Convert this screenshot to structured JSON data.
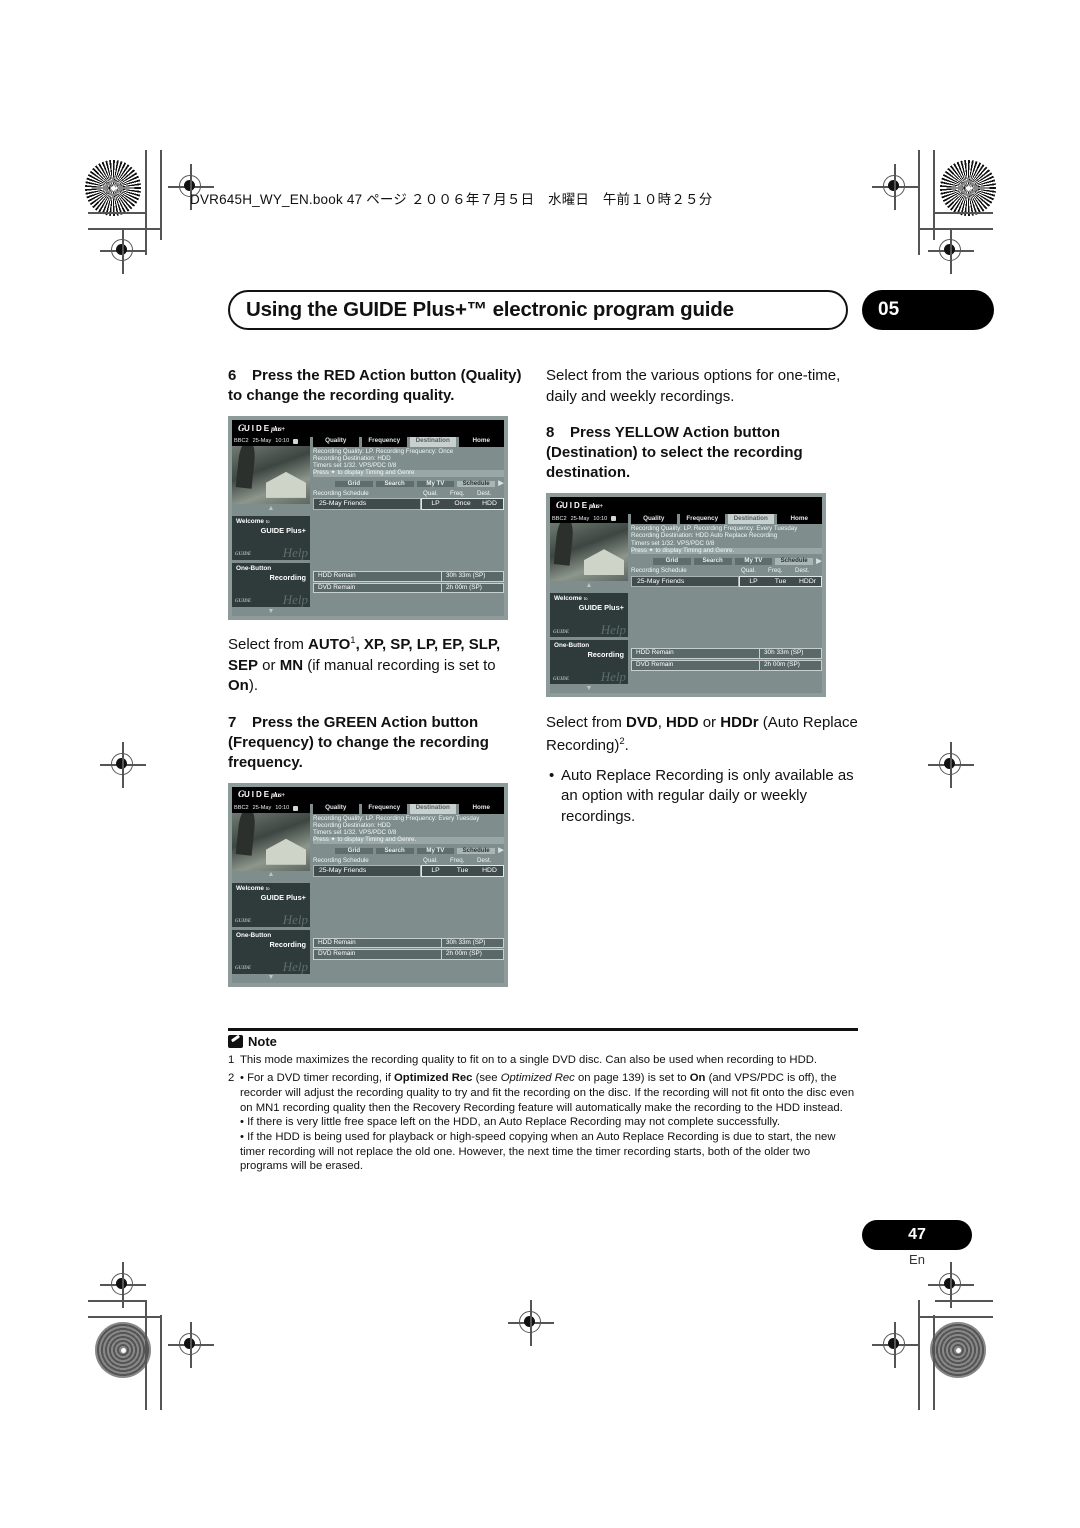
{
  "book_header": "DVR645H_WY_EN.book 47 ページ ２００６年７月５日　水曜日　午前１０時２５分",
  "title": "Using the GUIDE Plus+™ electronic program guide",
  "chapter": "05",
  "page_number": "47",
  "page_lang": "En",
  "left_column": {
    "step6": {
      "num": "6",
      "text": "Press the RED Action button (Quality) to change the recording quality."
    },
    "select_quality": {
      "lead": "Select from ",
      "auto": "AUTO",
      "sup": "1",
      "list": ", XP, SP, LP, EP, SLP, SEP",
      "or": " or ",
      "mn": "MN",
      "tail_pre": " (if manual recording is set to ",
      "on": "On",
      "tail_post": ")."
    },
    "step7": {
      "num": "7",
      "text": "Press the GREEN Action button (Frequency) to change the recording frequency."
    }
  },
  "right_column": {
    "intro": "Select from the various options for one-time, daily and weekly recordings.",
    "step8": {
      "num": "8",
      "text": "Press YELLOW Action button (Destination) to select the recording destination."
    },
    "select_dest": {
      "lead": "Select from ",
      "dvd": "DVD",
      "sep1": ", ",
      "hdd": "HDD",
      "sep2": " or ",
      "hddr": "HDDr",
      "tail": " (Auto Replace Recording)",
      "sup": "2",
      "period": "."
    },
    "bullets": [
      "Auto Replace Recording is only available as an option with regular daily or weekly recordings."
    ]
  },
  "figures": [
    {
      "logo": "GUIDE Plus+",
      "channel": "BBC2",
      "date": "25-May",
      "time": "10:10",
      "tabs": [
        {
          "label": "Quality",
          "selected": false
        },
        {
          "label": "Frequency",
          "selected": false
        },
        {
          "label": "Destination",
          "selected": true
        },
        {
          "label": "Home",
          "selected": false
        }
      ],
      "info": [
        "Recording Quality: LP. Recording Frequency: Once",
        "Recording Destination: HDD",
        "Timers set 1/32. VPS/PDC 0/8",
        "Press ✦ to display Timing and Genre"
      ],
      "nav": [
        {
          "label": "Grid",
          "selected": false
        },
        {
          "label": "Search",
          "selected": false
        },
        {
          "label": "My TV",
          "selected": false
        },
        {
          "label": "Schedule",
          "selected": true
        }
      ],
      "schedule_header": {
        "name": "Recording Schedule",
        "qual": "Qual.",
        "freq": "Freq.",
        "dest": "Dest."
      },
      "schedule_row": {
        "name": "25-May  Friends",
        "qual": "LP",
        "freq": "Once",
        "dest": "HDD"
      },
      "tiles": [
        {
          "line1": "Welcome",
          "small": "to",
          "line2": "GUIDE Plus+",
          "help": "Help"
        },
        {
          "line1": "One-Button",
          "small": "",
          "line2": "Recording",
          "help": "Help"
        }
      ],
      "remain": [
        {
          "label": "HDD Remain",
          "value": "30h 33m (SP)"
        },
        {
          "label": "DVD Remain",
          "value": "2h 00m (SP)"
        }
      ]
    },
    {
      "logo": "GUIDE Plus+",
      "channel": "BBC2",
      "date": "25-May",
      "time": "10:10",
      "tabs": [
        {
          "label": "Quality",
          "selected": false
        },
        {
          "label": "Frequency",
          "selected": false
        },
        {
          "label": "Destination",
          "selected": true
        },
        {
          "label": "Home",
          "selected": false
        }
      ],
      "info": [
        "Recording Quality: LP. Recording Frequency: Every Tuesday",
        "Recording Destination: HDD",
        "Timers set 1/32. VPS/PDC 0/8",
        "Press ✦ to display Timing and Genre."
      ],
      "nav": [
        {
          "label": "Grid",
          "selected": false
        },
        {
          "label": "Search",
          "selected": false
        },
        {
          "label": "My TV",
          "selected": false
        },
        {
          "label": "Schedule",
          "selected": true
        }
      ],
      "schedule_header": {
        "name": "Recording Schedule",
        "qual": "Qual.",
        "freq": "Freq.",
        "dest": "Dest."
      },
      "schedule_row": {
        "name": "25-May  Friends",
        "qual": "LP",
        "freq": "Tue",
        "dest": "HDD"
      },
      "tiles": [
        {
          "line1": "Welcome",
          "small": "to",
          "line2": "GUIDE Plus+",
          "help": "Help"
        },
        {
          "line1": "One-Button",
          "small": "",
          "line2": "Recording",
          "help": "Help"
        }
      ],
      "remain": [
        {
          "label": "HDD Remain",
          "value": "30h 33m (SP)"
        },
        {
          "label": "DVD Remain",
          "value": "2h 00m (SP)"
        }
      ]
    },
    {
      "logo": "GUIDE Plus+",
      "channel": "BBC2",
      "date": "25-May",
      "time": "10:10",
      "tabs": [
        {
          "label": "Quality",
          "selected": false
        },
        {
          "label": "Frequency",
          "selected": false
        },
        {
          "label": "Destination",
          "selected": true
        },
        {
          "label": "Home",
          "selected": false
        }
      ],
      "info": [
        "Recording Quality: LP. Recording Frequency: Every Tuesday",
        "Recording Destination: HDD Auto Replace Recording",
        "Timers set 1/32. VPS/PDC 0/8",
        "Press ✦ to display Timing and Genre."
      ],
      "nav": [
        {
          "label": "Grid",
          "selected": false
        },
        {
          "label": "Search",
          "selected": false
        },
        {
          "label": "My TV",
          "selected": false
        },
        {
          "label": "Schedule",
          "selected": true
        }
      ],
      "schedule_header": {
        "name": "Recording Schedule",
        "qual": "Qual.",
        "freq": "Freq.",
        "dest": "Dest."
      },
      "schedule_row": {
        "name": "25-May  Friends",
        "qual": "LP",
        "freq": "Tue",
        "dest": "HDDr"
      },
      "tiles": [
        {
          "line1": "Welcome",
          "small": "to",
          "line2": "GUIDE Plus+",
          "help": "Help"
        },
        {
          "line1": "One-Button",
          "small": "",
          "line2": "Recording",
          "help": "Help"
        }
      ],
      "remain": [
        {
          "label": "HDD Remain",
          "value": "30h 33m (SP)"
        },
        {
          "label": "DVD Remain",
          "value": "2h 00m (SP)"
        }
      ]
    }
  ],
  "note": {
    "heading": "Note",
    "items": [
      {
        "num": "1",
        "text": "This mode maximizes the recording quality to fit on to a single DVD disc. Can also be used when recording to HDD."
      },
      {
        "num": "2",
        "text_pre": "• For a DVD timer recording, if ",
        "bold1": "Optimized Rec",
        "text_mid1": " (see ",
        "italic1": "Optimized Rec",
        "text_mid2": " on page 139) is set to ",
        "bold2": "On",
        "text_post": " (and VPS/PDC is off), the recorder will adjust the recording quality to try and fit the recording on the disc. If the recording will not fit onto the disc even on MN1 recording quality then the Recovery Recording feature will automatically make the recording to the HDD instead."
      }
    ],
    "sub_bullets": [
      "• If there is very little free space left on the HDD, an Auto Replace Recording may not complete successfully.",
      "• If the HDD is being used for playback or high-speed copying when an Auto Replace Recording is due to start, the new timer recording will not replace the old one. However, the next time the timer recording starts, both of the older two programs will be erased."
    ]
  }
}
